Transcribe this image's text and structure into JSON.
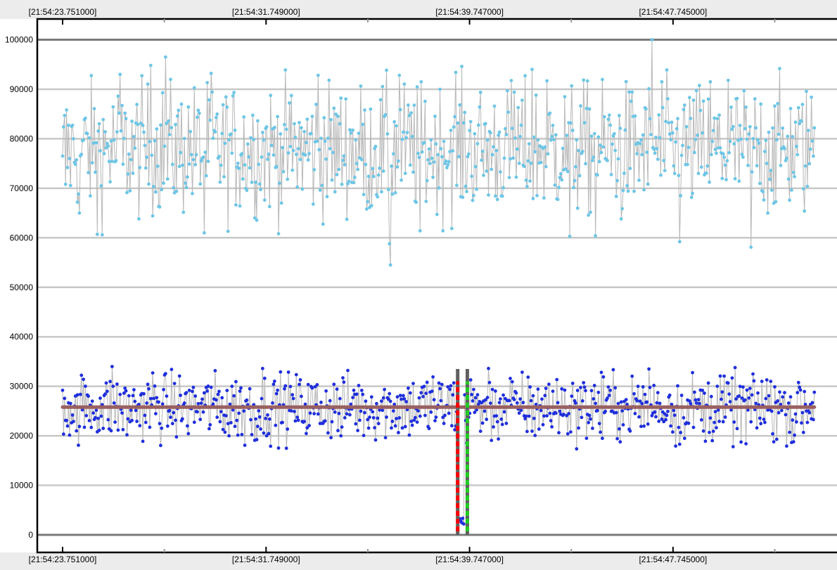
{
  "chart_data": {
    "type": "scatter",
    "x_axis": {
      "tick_labels": [
        "[21:54:23.751000]",
        "[21:54:31.749000]",
        "[21:54:39.747000]",
        "[21:54:47.745000]"
      ],
      "tick_seconds": [
        23.751,
        31.749,
        39.747,
        47.745
      ],
      "range_seconds": [
        22.8,
        53.4
      ]
    },
    "y_axis": {
      "tick_labels": [
        "0",
        "10000",
        "20000",
        "30000",
        "40000",
        "50000",
        "60000",
        "70000",
        "80000",
        "90000",
        "100000"
      ],
      "range": [
        -2500,
        104500
      ]
    },
    "grid": true,
    "series": [
      {
        "color": "#6ec6e6",
        "marker": "circle",
        "connected": true,
        "x_range_seconds": [
          23.751,
          53.3
        ],
        "mean": 77800,
        "min": 54500,
        "max": 100000,
        "sample_points": [
          {
            "x": 23.75,
            "y": 76500
          },
          {
            "x": 23.85,
            "y": 70800
          },
          {
            "x": 24.4,
            "y": 65000
          },
          {
            "x": 25.1,
            "y": 60700
          },
          {
            "x": 26.0,
            "y": 93000
          },
          {
            "x": 27.2,
            "y": 94800
          },
          {
            "x": 27.8,
            "y": 96500
          },
          {
            "x": 29.6,
            "y": 93200
          },
          {
            "x": 29.3,
            "y": 61000
          },
          {
            "x": 33.8,
            "y": 92800
          },
          {
            "x": 35.7,
            "y": 65800
          },
          {
            "x": 36.6,
            "y": 58800
          },
          {
            "x": 36.65,
            "y": 54500
          },
          {
            "x": 37.0,
            "y": 92800
          },
          {
            "x": 37.8,
            "y": 61400
          },
          {
            "x": 39.2,
            "y": 93400
          },
          {
            "x": 41.5,
            "y": 89400
          },
          {
            "x": 42.2,
            "y": 94000
          },
          {
            "x": 42.8,
            "y": 91700
          },
          {
            "x": 43.7,
            "y": 60300
          },
          {
            "x": 44.7,
            "y": 60400
          },
          {
            "x": 45.7,
            "y": 63800
          },
          {
            "x": 46.9,
            "y": 100000
          },
          {
            "x": 47.3,
            "y": 91500
          },
          {
            "x": 48.0,
            "y": 59200
          },
          {
            "x": 49.2,
            "y": 91500
          },
          {
            "x": 49.9,
            "y": 91800
          },
          {
            "x": 50.8,
            "y": 58100
          },
          {
            "x": 53.3,
            "y": 82200
          }
        ]
      },
      {
        "color": "#1f2fdc",
        "marker": "circle",
        "connected": true,
        "x_range_seconds": [
          23.751,
          53.3
        ],
        "mean": 25800,
        "min": 1500,
        "max": 34000,
        "dip": {
          "x_start": 39.28,
          "x_end": 39.53,
          "y": 2000
        },
        "sample_points": [
          {
            "x": 23.75,
            "y": 29200
          },
          {
            "x": 24.3,
            "y": 21000
          },
          {
            "x": 25.7,
            "y": 34000
          },
          {
            "x": 26.3,
            "y": 20200
          },
          {
            "x": 27.3,
            "y": 32700
          },
          {
            "x": 29.6,
            "y": 29800
          },
          {
            "x": 30.3,
            "y": 20000
          },
          {
            "x": 30.9,
            "y": 18100
          },
          {
            "x": 31.3,
            "y": 19100
          },
          {
            "x": 31.6,
            "y": 33600
          },
          {
            "x": 34.7,
            "y": 20000
          },
          {
            "x": 35.2,
            "y": 29200
          },
          {
            "x": 37.9,
            "y": 29800
          },
          {
            "x": 38.3,
            "y": 31900
          },
          {
            "x": 38.8,
            "y": 26000
          },
          {
            "x": 39.0,
            "y": 30100
          },
          {
            "x": 39.3,
            "y": 2000
          },
          {
            "x": 39.5,
            "y": 2200
          },
          {
            "x": 39.8,
            "y": 31300
          },
          {
            "x": 40.5,
            "y": 33600
          },
          {
            "x": 45.0,
            "y": 31900
          },
          {
            "x": 46.8,
            "y": 33500
          },
          {
            "x": 48.0,
            "y": 18300
          },
          {
            "x": 49.0,
            "y": 18900
          },
          {
            "x": 49.5,
            "y": 30000
          },
          {
            "x": 50.6,
            "y": 18400
          },
          {
            "x": 51.6,
            "y": 31000
          },
          {
            "x": 52.5,
            "y": 18800
          },
          {
            "x": 53.3,
            "y": 28800
          }
        ]
      }
    ],
    "reference_lines": [
      {
        "kind": "horizontal",
        "y": 25800,
        "x_range_seconds": [
          23.751,
          53.3
        ],
        "color": "#9a6060"
      }
    ],
    "markers": [
      {
        "kind": "vertical",
        "x": 39.28,
        "y_range": [
          0,
          33500
        ],
        "color": "#606060",
        "inner_dash_color": "#ff0000"
      },
      {
        "kind": "vertical",
        "x": 39.66,
        "y_range": [
          0,
          33500
        ],
        "color": "#606060",
        "inner_dash_color": "#22cc22"
      }
    ]
  }
}
